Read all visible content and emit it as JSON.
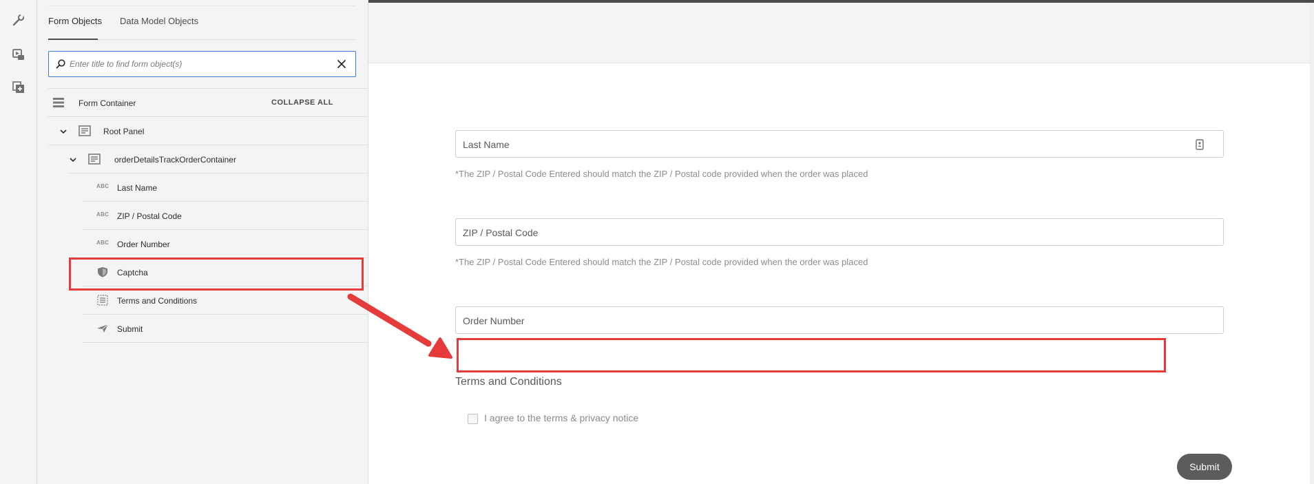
{
  "rail": {
    "icons": [
      "wrench-icon",
      "media-icon",
      "add-page-icon"
    ]
  },
  "panel": {
    "tabs": [
      {
        "label": "Form Objects",
        "active": true
      },
      {
        "label": "Data Model Objects",
        "active": false
      }
    ],
    "search": {
      "placeholder": "Enter title to find form object(s)",
      "value": ""
    },
    "container": {
      "label": "Form Container",
      "collapse_all": "COLLAPSE ALL"
    },
    "tree": {
      "root_panel": "Root Panel",
      "sub_container": "orderDetailsTrackOrderContainer",
      "items": [
        {
          "label": "Last Name",
          "icon": "abc-text-icon",
          "type_tag": "ABC"
        },
        {
          "label": "ZIP / Postal Code",
          "icon": "abc-text-icon",
          "type_tag": "ABC"
        },
        {
          "label": "Order Number",
          "icon": "abc-text-icon",
          "type_tag": "ABC"
        },
        {
          "label": "Captcha",
          "icon": "shield-icon",
          "type_tag": ""
        },
        {
          "label": "Terms and Conditions",
          "icon": "terms-icon",
          "type_tag": ""
        },
        {
          "label": "Submit",
          "icon": "paper-plane-icon",
          "type_tag": ""
        }
      ]
    }
  },
  "form": {
    "fields": [
      {
        "label": "Last Name",
        "help": "*The ZIP / Postal Code Entered should match the ZIP / Postal code provided when the order was placed"
      },
      {
        "label": "ZIP / Postal Code",
        "help": "*The ZIP / Postal Code Entered should match the ZIP / Postal code provided when the order was placed"
      },
      {
        "label": "Order Number",
        "help": ""
      }
    ],
    "terms_title": "Terms and Conditions",
    "agree_label": "I agree to the terms & privacy notice",
    "agree_checked": false,
    "submit_label": "Submit"
  },
  "colors": {
    "annotation_red": "#e53b3b",
    "search_focus_blue": "#3a7bd5",
    "submit_gray": "#5c5c5c"
  }
}
